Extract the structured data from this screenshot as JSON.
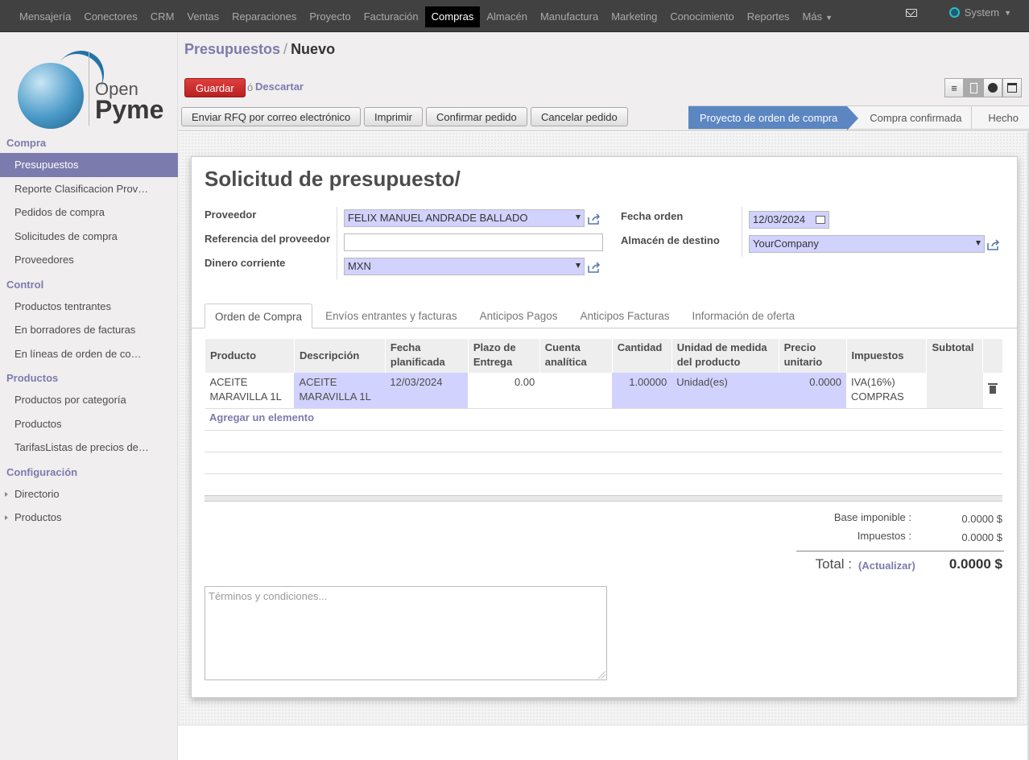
{
  "topbar": {
    "menu": [
      "Mensajería",
      "Conectores",
      "CRM",
      "Ventas",
      "Reparaciones",
      "Proyecto",
      "Facturación",
      "Compras",
      "Almacén",
      "Manufactura",
      "Marketing",
      "Conocimiento",
      "Reportes",
      "Más"
    ],
    "active": "Compras",
    "user": "System"
  },
  "logo": {
    "open": "Open",
    "pyme": "Pyme"
  },
  "sidebar": {
    "sections": [
      {
        "title": "Compra",
        "items": [
          "Presupuestos",
          "Reporte Clasificacion Prov…",
          "Pedidos de compra",
          "Solicitudes de compra",
          "Proveedores"
        ]
      },
      {
        "title": "Control",
        "items": [
          "Productos tentrantes",
          "En borradores de facturas",
          "En líneas de orden de co…"
        ]
      },
      {
        "title": "Productos",
        "items": [
          "Productos por categoría",
          "Productos",
          "TarifasListas de precios de…"
        ]
      },
      {
        "title": "Configuración",
        "items": [
          "Directorio",
          "Productos"
        ]
      }
    ],
    "active_item": "Presupuestos"
  },
  "breadcrumb": {
    "parent": "Presupuestos",
    "separator": "/",
    "current": "Nuevo"
  },
  "buttons": {
    "save": "Guardar",
    "or": "ó",
    "discard": "Descartar"
  },
  "actions": [
    "Enviar RFQ por correo electrónico",
    "Imprimir",
    "Confirmar pedido",
    "Cancelar pedido"
  ],
  "statusbar": [
    "Proyecto de orden de compra",
    "Compra confirmada",
    "Hecho"
  ],
  "form": {
    "title": "Solicitud de presupuesto/",
    "proveedor_label": "Proveedor",
    "proveedor": "FELIX MANUEL ANDRADE BALLADO",
    "ref_label": "Referencia del proveedor",
    "ref": "",
    "dinero_label": "Dinero corriente",
    "dinero": "MXN",
    "fecha_label": "Fecha orden",
    "fecha": "12/03/2024",
    "almacen_label": "Almacén de destino",
    "almacen": "YourCompany"
  },
  "tabs": [
    "Orden de Compra",
    "Envíos entrantes y facturas",
    "Anticipos Pagos",
    "Anticipos Facturas",
    "Información de oferta"
  ],
  "table": {
    "headers": [
      "Producto",
      "Descripción",
      "Fecha planificada",
      "Plazo de Entrega",
      "Cuenta analítica",
      "Cantidad",
      "Unidad de medida del producto",
      "Precio unitario",
      "Impuestos",
      "Subtotal"
    ],
    "row": {
      "producto": "ACEITE MARAVILLA 1L",
      "descripcion": "ACEITE MARAVILLA 1L",
      "fecha": "12/03/2024",
      "plazo": "0.00",
      "cuenta": "",
      "cantidad": "1.00000",
      "unidad": "Unidad(es)",
      "precio": "0.0000",
      "impuestos": "IVA(16%) COMPRAS",
      "subtotal": ""
    },
    "add": "Agregar un elemento"
  },
  "totals": {
    "base_label": "Base imponible :",
    "base": "0.0000 $",
    "tax_label": "Impuestos :",
    "tax": "0.0000 $",
    "total_label": "Total :",
    "update": "(Actualizar)",
    "total": "0.0000 $"
  },
  "terms_placeholder": "Términos y condiciones..."
}
